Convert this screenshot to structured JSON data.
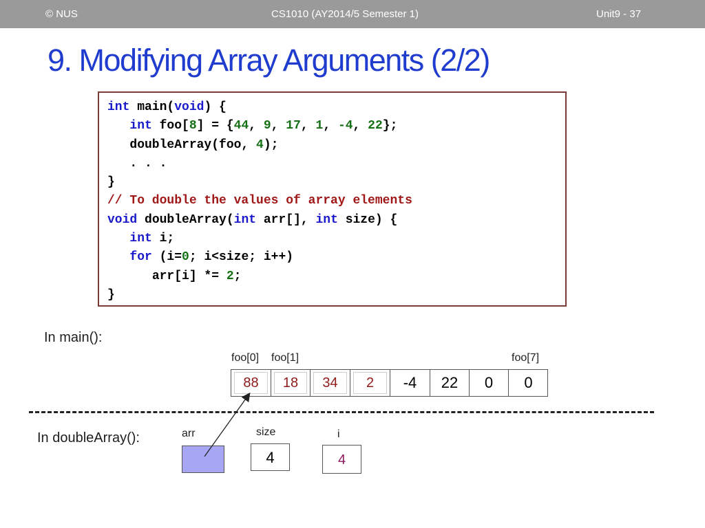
{
  "header": {
    "copyright": "© NUS",
    "course": "CS1010 (AY2014/5 Semester 1)",
    "slide": "Unit9 - 37"
  },
  "title": "9. Modifying Array Arguments (2/2)",
  "code": {
    "main_sig_kw": "int",
    "main_sig_name": " main(",
    "main_sig_void": "void",
    "main_sig_end": ") {",
    "foo_kw": "int",
    "foo_decl_a": " foo[",
    "foo_size": "8",
    "foo_decl_b": "] = {",
    "v0": "44",
    "v1": "9",
    "v2": "17",
    "v3": "1",
    "v4": "-4",
    "v5": "22",
    "foo_decl_end": "};",
    "call_a": "doubleArray(foo, ",
    "call_arg": "4",
    "call_end": ");",
    "ellipsis": ". . .",
    "close": "}",
    "comment": "// To double the values of array elements",
    "da_void": "void",
    "da_name": " doubleArray(",
    "da_int1": "int",
    "da_arr": " arr[], ",
    "da_int2": "int",
    "da_size": " size) {",
    "decl_kw": "int",
    "decl_rest": " i;",
    "for_kw": "for",
    "for_a": " (i=",
    "for_zero": "0",
    "for_b": "; i<size; i++)",
    "body_a": "arr[i] *= ",
    "body_two": "2",
    "body_end": ";",
    "close2": "}"
  },
  "main_label": "In main():",
  "foo_labels": {
    "first": "foo[0]",
    "second": "foo[1]",
    "last": "foo[7]"
  },
  "foo_values": [
    "88",
    "18",
    "34",
    "2",
    "-4",
    "22",
    "0",
    "0"
  ],
  "double_label": "In doubleArray():",
  "params": {
    "arr_label": "arr",
    "size_label": "size",
    "size_value": "4",
    "i_label": "i",
    "i_value": "4"
  },
  "colors": {
    "topbar": "#9a9a9a",
    "title": "#1f3ccf",
    "keyword": "#1a1acc",
    "number": "#157015",
    "comment": "#a01818",
    "changed_value": "#8e1a1a",
    "arr_box": "#a6a6f5",
    "i_value": "#8a1a5a"
  }
}
